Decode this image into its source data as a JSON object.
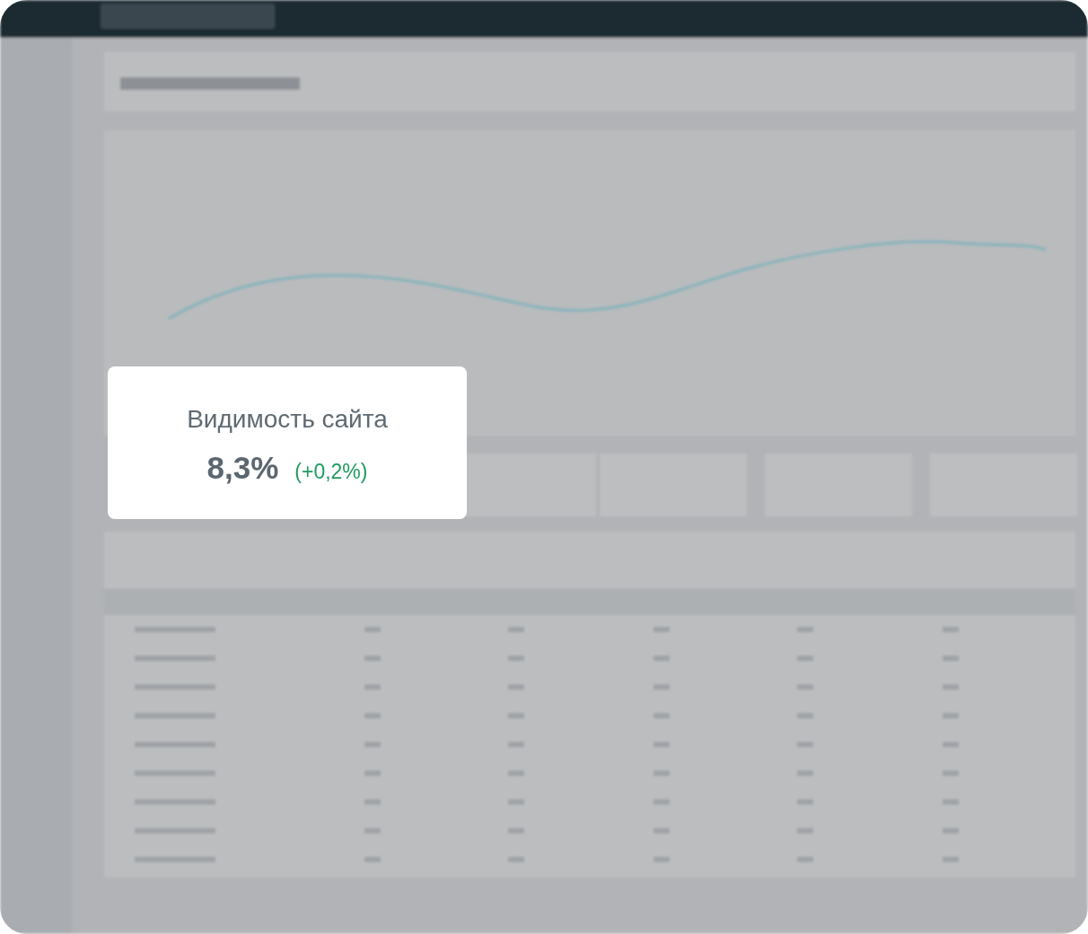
{
  "visibility_card": {
    "title": "Видимость сайта",
    "value": "8,3%",
    "change": "(+0,2%)",
    "positive": true
  }
}
